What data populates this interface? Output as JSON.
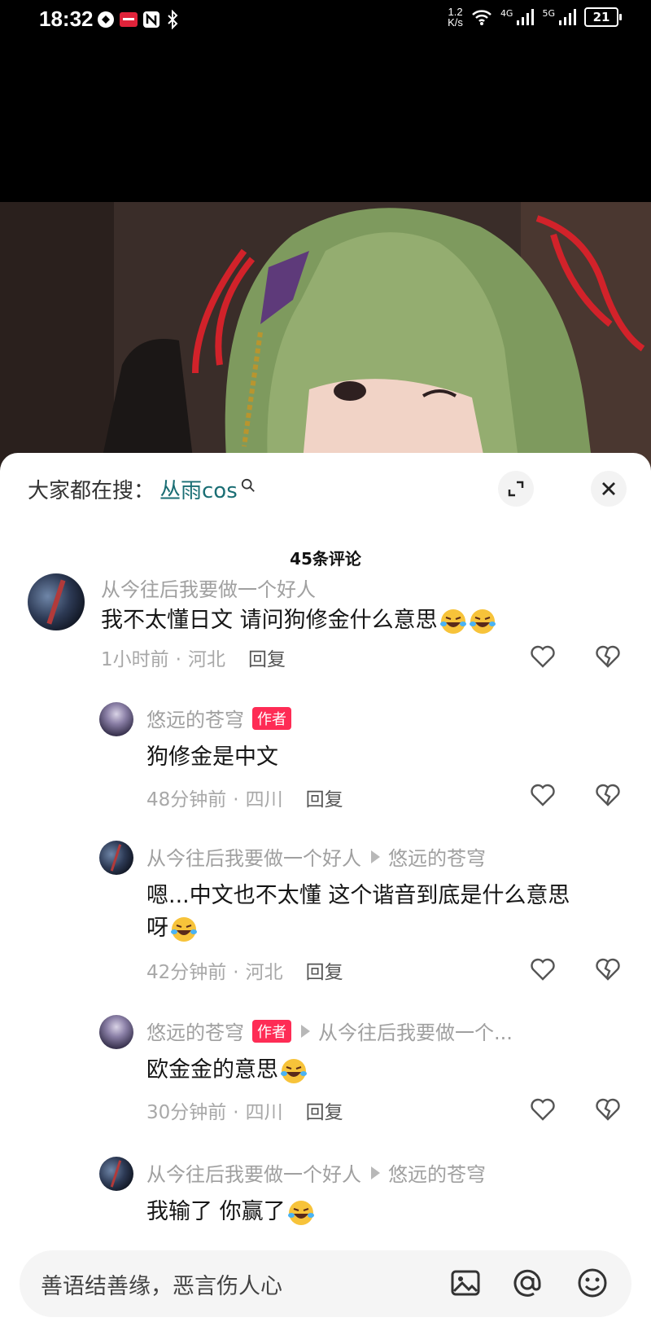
{
  "status": {
    "time": "18:32",
    "speed_top": "1.2",
    "speed_bottom": "K/s",
    "net1": "4G",
    "net2": "5G",
    "battery": "21"
  },
  "panel": {
    "search_prefix": "大家都在搜：",
    "search_term": "丛雨cos",
    "comment_count": "45条评论"
  },
  "comments": [
    {
      "user": "从今往后我要做一个好人",
      "text": "我不太懂日文 请问狗修金什么意思",
      "time": "1小时前",
      "location": "河北",
      "reply": "回复"
    },
    {
      "user": "悠远的苍穹",
      "tag": "作者",
      "text": "狗修金是中文",
      "time": "48分钟前",
      "location": "四川",
      "reply": "回复"
    },
    {
      "user": "从今往后我要做一个好人",
      "reply_to": "悠远的苍穹",
      "text_line1": "嗯...中文也不太懂 这个谐音到底是什么意思",
      "text_line2": "呀",
      "time": "42分钟前",
      "location": "河北",
      "reply": "回复"
    },
    {
      "user": "悠远的苍穹",
      "tag": "作者",
      "reply_to": "从今往后我要做一个...",
      "text": "欧金金的意思",
      "time": "30分钟前",
      "location": "四川",
      "reply": "回复"
    },
    {
      "user": "从今往后我要做一个好人",
      "reply_to": "悠远的苍穹",
      "text": "我输了 你赢了"
    }
  ],
  "input": {
    "placeholder": "善语结善缘，恶言伤人心"
  },
  "colors": {
    "accent": "#fe2c55",
    "search_link": "#1a6e74"
  }
}
